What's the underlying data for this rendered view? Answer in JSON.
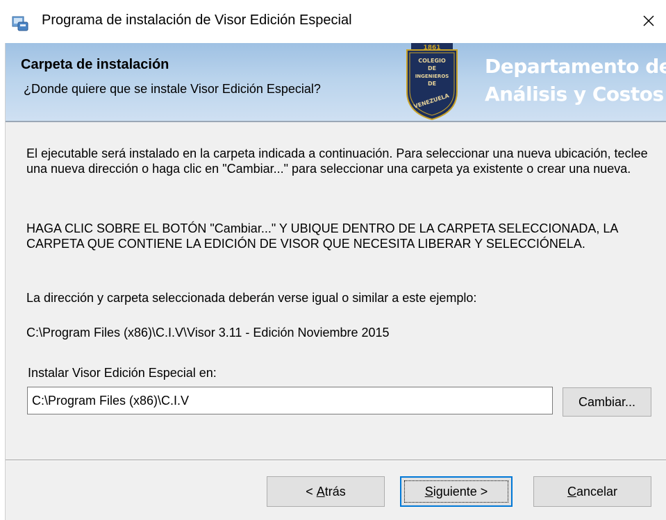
{
  "window": {
    "title": "Programa de instalación de Visor Edición Especial",
    "close_icon": "close-icon",
    "app_icon": "installer-icon"
  },
  "banner": {
    "title": "Carpeta de instalación",
    "subtitle": "¿Donde quiere que se instale Visor Edición Especial?",
    "logo_year": "1861",
    "logo_lines": [
      "COLEGIO",
      "DE",
      "INGENIEROS",
      "DE",
      "VENEZUELA"
    ],
    "department_line1": "Departamento de",
    "department_line2": "Análisis y Costos",
    "colors": {
      "gradient_top": "#9fc1e3",
      "gradient_bottom": "#cfe0f2",
      "seal_fill": "#1c2f5c",
      "seal_ring": "#c9a227"
    }
  },
  "body": {
    "paragraph1": "El ejecutable será instalado en la carpeta indicada a continuación. Para seleccionar una nueva ubicación, teclee una nueva dirección o haga clic en \"Cambiar...\" para seleccionar una carpeta ya existente o crear una nueva.",
    "paragraph2": "HAGA CLIC SOBRE EL BOTÓN \"Cambiar...\" Y UBIQUE DENTRO DE LA CARPETA SELECCIONADA, LA CARPETA QUE CONTIENE LA EDICIÓN DE VISOR QUE NECESITA LIBERAR Y SELECCIÓNELA.",
    "paragraph3": "La dirección y carpeta seleccionada deberán verse igual o similar a este ejemplo:",
    "example_path": "C:\\Program Files (x86)\\C.I.V\\Visor 3.11 - Edición Noviembre 2015",
    "field_label": "Instalar Visor Edición Especial en:",
    "field_value": "C:\\Program Files (x86)\\C.I.V",
    "change_button": "Cambiar..."
  },
  "footer": {
    "back_button": {
      "accel": "A",
      "rest": "trás",
      "prefix": "< "
    },
    "next_button": {
      "accel": "S",
      "rest": "iguiente >"
    },
    "cancel_button": {
      "accel": "C",
      "rest": "ancelar"
    },
    "focus_color": "#0078d7"
  }
}
